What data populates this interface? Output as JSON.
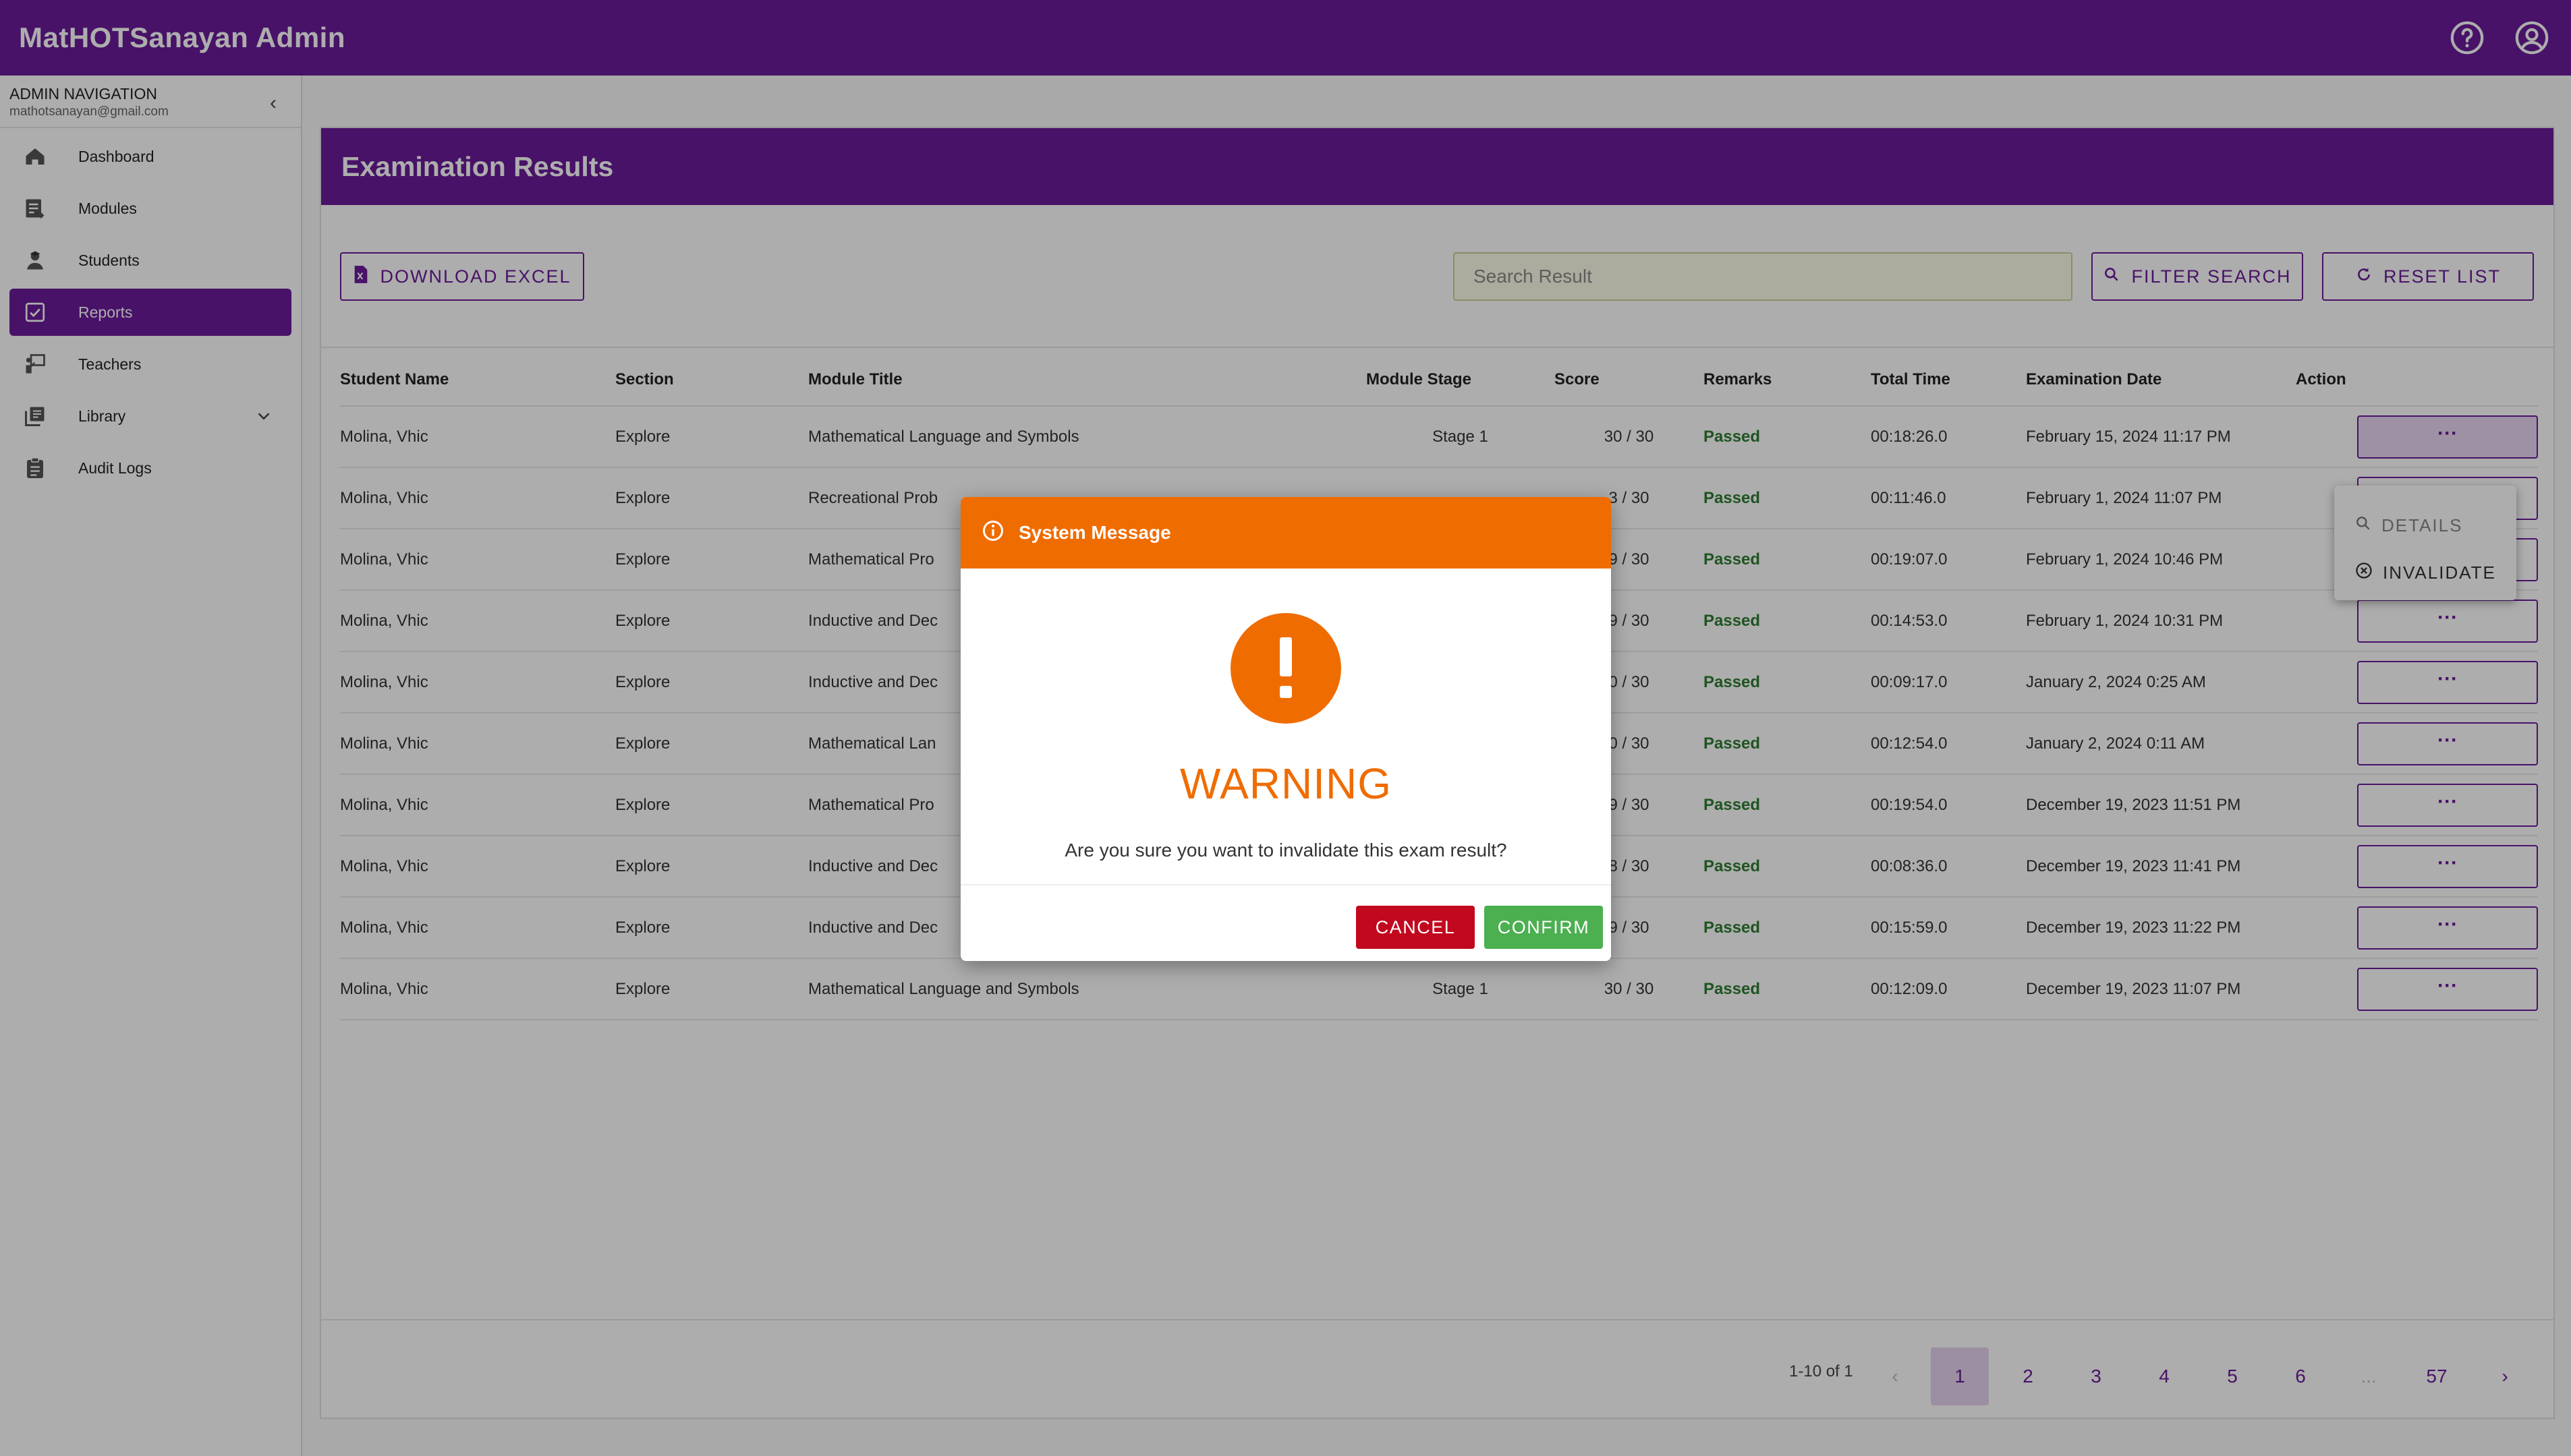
{
  "app": {
    "title": "MatHOTSanayan Admin",
    "accent": "#6a1b9a"
  },
  "topbar": {
    "icons": [
      "help-icon",
      "account-icon"
    ]
  },
  "sidebar": {
    "heading": "ADMIN NAVIGATION",
    "email": "mathotsanayan@gmail.com",
    "items": [
      {
        "label": "Dashboard",
        "icon": "home-icon"
      },
      {
        "label": "Modules",
        "icon": "modules-icon"
      },
      {
        "label": "Students",
        "icon": "student-icon"
      },
      {
        "label": "Reports",
        "icon": "reports-icon",
        "active": true
      },
      {
        "label": "Teachers",
        "icon": "teacher-icon"
      },
      {
        "label": "Library",
        "icon": "library-icon",
        "expandable": true
      },
      {
        "label": "Audit Logs",
        "icon": "clipboard-icon"
      }
    ]
  },
  "page": {
    "title": "Examination Results",
    "download_label": "DOWNLOAD EXCEL",
    "search_placeholder": "Search Result",
    "filter_label": "FILTER SEARCH",
    "reset_label": "RESET LIST"
  },
  "table": {
    "columns": [
      "Student Name",
      "Section",
      "Module Title",
      "Module Stage",
      "Score",
      "Remarks",
      "Total Time",
      "Examination Date",
      "Action"
    ],
    "rows": [
      [
        "Molina, Vhic",
        "Explore",
        "Mathematical Language and Symbols",
        "Stage 1",
        "30 / 30",
        "Passed",
        "00:18:26.0",
        "February 15, 2024 11:17 PM",
        "···"
      ],
      [
        "Molina, Vhic",
        "Explore",
        "Recreational Prob",
        "",
        "3 / 30",
        "Passed",
        "00:11:46.0",
        "February 1, 2024 11:07 PM",
        "···"
      ],
      [
        "Molina, Vhic",
        "Explore",
        "Mathematical Pro",
        "",
        "9 / 30",
        "Passed",
        "00:19:07.0",
        "February 1, 2024 10:46 PM",
        "···"
      ],
      [
        "Molina, Vhic",
        "Explore",
        "Inductive and Dec",
        "",
        "9 / 30",
        "Passed",
        "00:14:53.0",
        "February 1, 2024 10:31 PM",
        "···"
      ],
      [
        "Molina, Vhic",
        "Explore",
        "Inductive and Dec",
        "",
        "0 / 30",
        "Passed",
        "00:09:17.0",
        "January 2, 2024 0:25 AM",
        "···"
      ],
      [
        "Molina, Vhic",
        "Explore",
        "Mathematical Lan",
        "",
        "0 / 30",
        "Passed",
        "00:12:54.0",
        "January 2, 2024 0:11 AM",
        "···"
      ],
      [
        "Molina, Vhic",
        "Explore",
        "Mathematical Pro",
        "",
        "9 / 30",
        "Passed",
        "00:19:54.0",
        "December 19, 2023 11:51 PM",
        "···"
      ],
      [
        "Molina, Vhic",
        "Explore",
        "Inductive and Dec",
        "",
        "8 / 30",
        "Passed",
        "00:08:36.0",
        "December 19, 2023 11:41 PM",
        "···"
      ],
      [
        "Molina, Vhic",
        "Explore",
        "Inductive and Dec",
        "",
        "9 / 30",
        "Passed",
        "00:15:59.0",
        "December 19, 2023 11:22 PM",
        "···"
      ],
      [
        "Molina, Vhic",
        "Explore",
        "Mathematical Language and Symbols",
        "Stage 1",
        "30 / 30",
        "Passed",
        "00:12:09.0",
        "December 19, 2023 11:07 PM",
        "···"
      ]
    ]
  },
  "action_menu": {
    "details": "DETAILS",
    "invalidate": "INVALIDATE"
  },
  "pagination": {
    "info": "1-10 of 1",
    "pages": [
      "1",
      "2",
      "3",
      "4",
      "5",
      "6",
      "...",
      "57"
    ],
    "current": "1"
  },
  "dialog": {
    "header": "System Message",
    "title": "WARNING",
    "message": "Are you sure you want to invalidate this exam result?",
    "cancel_label": "CANCEL",
    "confirm_label": "CONFIRM",
    "colors": {
      "header": "#ef6c00",
      "cancel": "#c2081e",
      "confirm": "#4caf50"
    }
  }
}
